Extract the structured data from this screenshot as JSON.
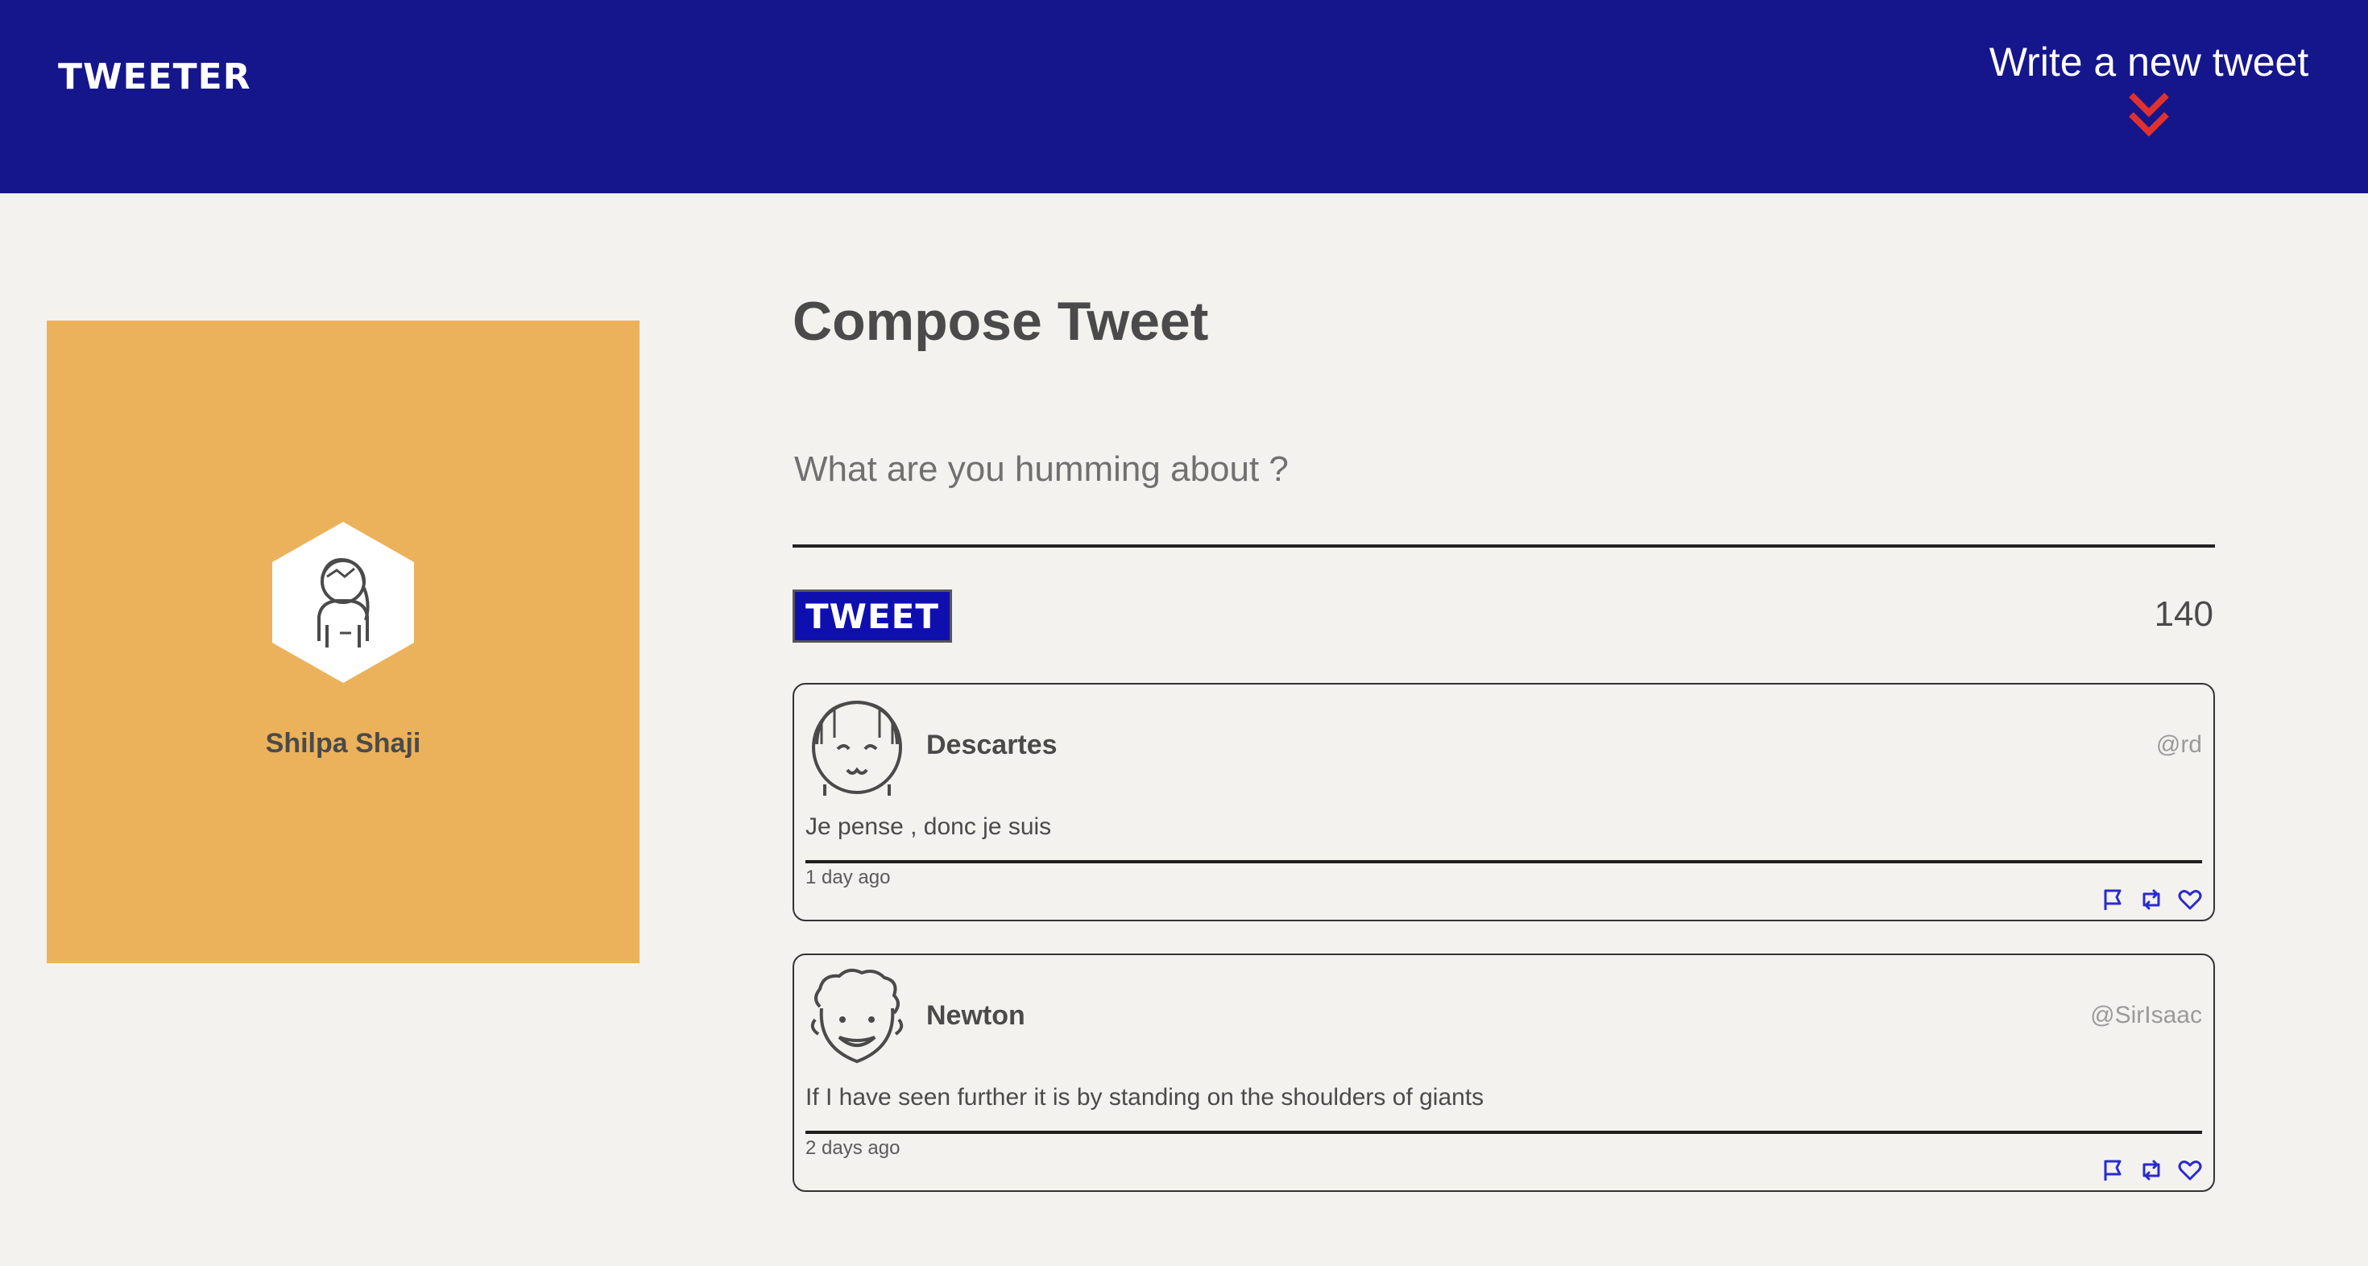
{
  "nav": {
    "brand": "TWEETER",
    "write_label": "Write a new tweet",
    "chevron_icon": "double-chevron-down-icon",
    "chevron_color": "#e0312e"
  },
  "profile": {
    "name": "Shilpa Shaji",
    "avatar_icon": "user-avatar-icon",
    "card_color": "#ebb25b"
  },
  "compose": {
    "title": "Compose Tweet",
    "placeholder": "What are you humming about ?",
    "value": "",
    "button_label": "TWEET",
    "counter": "140"
  },
  "tweets": [
    {
      "name": "Descartes",
      "handle": "@rd",
      "text": "Je pense , donc je suis",
      "time": "1 day ago",
      "avatar_icon": "girl-avatar-icon",
      "actions": [
        "flag-icon",
        "retweet-icon",
        "heart-icon"
      ]
    },
    {
      "name": "Newton",
      "handle": "@SirIsaac",
      "text": "If I have seen further it is by standing on the shoulders of giants",
      "time": "2 days ago",
      "avatar_icon": "man-avatar-icon",
      "actions": [
        "flag-icon",
        "retweet-icon",
        "heart-icon"
      ]
    }
  ],
  "colors": {
    "nav_bg": "#15168b",
    "page_bg": "#f3f2ef",
    "button_bg": "#0f0fb0",
    "action_icon": "#2a2ad0"
  }
}
